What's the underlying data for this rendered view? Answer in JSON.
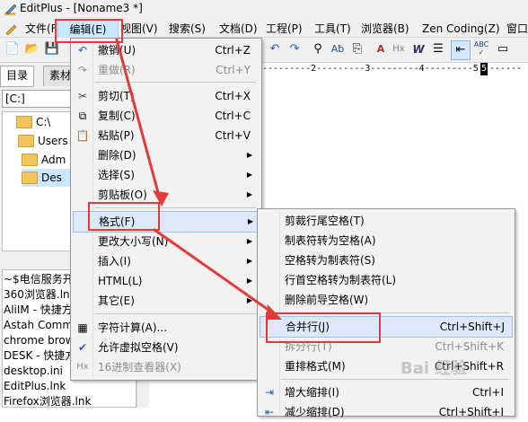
{
  "window": {
    "title": "EditPlus - [Noname3 *]"
  },
  "menubar": {
    "items": [
      {
        "label": "文件(F)"
      },
      {
        "label": "编辑(E)"
      },
      {
        "label": "视图(V)"
      },
      {
        "label": "搜索(S)"
      },
      {
        "label": "文档(D)"
      },
      {
        "label": "工程(P)"
      },
      {
        "label": "工具(T)"
      },
      {
        "label": "浏览器(B)"
      },
      {
        "label": "Zen Coding(Z)"
      },
      {
        "label": "窗口"
      }
    ]
  },
  "toolbar": {
    "icons": [
      "new-file",
      "open-folder",
      "save",
      "undo",
      "redo",
      "find",
      "find-replace",
      "go-to-line",
      "html-toolbar",
      "hex-view",
      "word-wrap",
      "line-numbers",
      "spell-check",
      "window"
    ]
  },
  "ruler": {
    "text": "---------2---------3---------4---------5--------",
    "cursor": "5"
  },
  "left_panel": {
    "tabs": [
      "目录",
      "素材"
    ],
    "drive": "[C:]",
    "tree": [
      "C:\\",
      "Users",
      "Adm",
      "Des"
    ],
    "files": [
      "~$电信服务开",
      "360浏览器.lnk",
      "AliIM - 快捷方",
      "Astah Comm",
      "chrome brow",
      "DESK - 快捷方",
      "desktop.ini",
      "EditPlus.lnk",
      "Firefox浏览器.lnk"
    ]
  },
  "edit_menu": {
    "items": [
      {
        "label": "撤销(U)",
        "shortcut": "Ctrl+Z",
        "icon": "undo-icon",
        "enabled": true
      },
      {
        "label": "重做(R)",
        "shortcut": "Ctrl+Y",
        "icon": "redo-icon",
        "enabled": false
      },
      {
        "label": "剪切(T)",
        "shortcut": "Ctrl+X",
        "icon": "cut-icon",
        "enabled": true
      },
      {
        "label": "复制(C)",
        "shortcut": "Ctrl+C",
        "icon": "copy-icon",
        "enabled": true
      },
      {
        "label": "粘贴(P)",
        "shortcut": "Ctrl+V",
        "icon": "paste-icon",
        "enabled": true
      },
      {
        "label": "删除(D)",
        "submenu": true
      },
      {
        "label": "选择(S)",
        "submenu": true
      },
      {
        "label": "剪贴板(O)",
        "submenu": true
      },
      {
        "label": "格式(F)",
        "submenu": true,
        "highlighted": true
      },
      {
        "label": "更改大小写(N)",
        "submenu": true
      },
      {
        "label": "插入(I)",
        "submenu": true
      },
      {
        "label": "HTML(L)",
        "submenu": true
      },
      {
        "label": "其它(E)",
        "submenu": true
      },
      {
        "label": "字符计算(A)...",
        "icon": "calculator-icon"
      },
      {
        "label": "允许虚拟空格(V)",
        "icon": "check-icon",
        "checked": true
      },
      {
        "label": "16进制查看器(X)",
        "icon": "hex-icon",
        "enabled": false
      }
    ]
  },
  "format_submenu": {
    "items": [
      {
        "label": "剪裁行尾空格(T)"
      },
      {
        "label": "制表符转为空格(A)"
      },
      {
        "label": "空格转为制表符(S)"
      },
      {
        "label": "行首空格转为制表符(L)"
      },
      {
        "label": "删除前导空格(W)"
      },
      {
        "label": "合并行(J)",
        "shortcut": "Ctrl+Shift+J",
        "highlighted": true
      },
      {
        "label": "拆分行(T)",
        "shortcut": "Ctrl+Shift+K",
        "enabled": false
      },
      {
        "label": "重排格式(M)",
        "shortcut": "Ctrl+Shift+R"
      },
      {
        "label": "增大缩排(I)",
        "shortcut": "Ctrl+I",
        "icon": "indent-icon"
      },
      {
        "label": "减少缩排(D)",
        "shortcut": "Ctrl+Shift+I",
        "icon": "outdent-icon"
      }
    ]
  },
  "colors": {
    "annotation": "#e53a3a",
    "menu_bg": "#f2f2f2",
    "highlight": "#dde9f8"
  },
  "watermark": "Bai 经验"
}
